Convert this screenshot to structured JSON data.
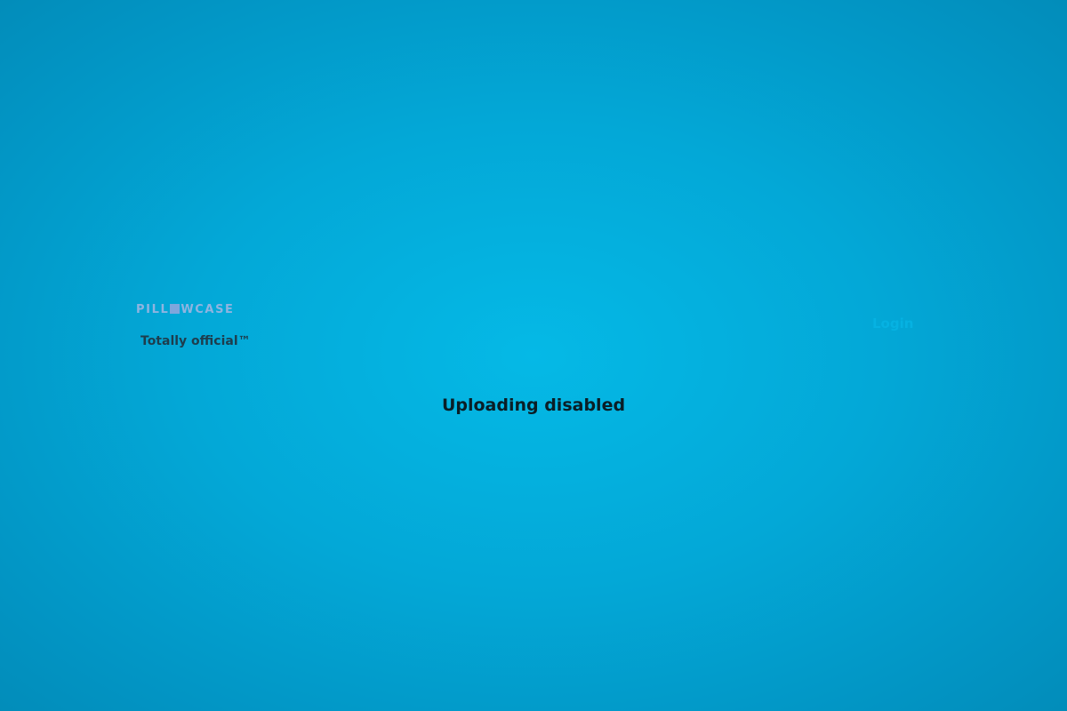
{
  "header": {
    "logo": {
      "text_before": "PILL",
      "text_after": "WCASE",
      "box_color": "#7fa6dc",
      "text_color": "#8fb4e0"
    },
    "tagline": "Totally official™",
    "login_label": "Login"
  },
  "main": {
    "message": "Uploading disabled"
  },
  "colors": {
    "background_center": "#05b9e6",
    "background_edge": "#0283ae",
    "login_link": "#06b2e2",
    "tagline": "#1e3d4d",
    "message": "#0a1e26"
  }
}
